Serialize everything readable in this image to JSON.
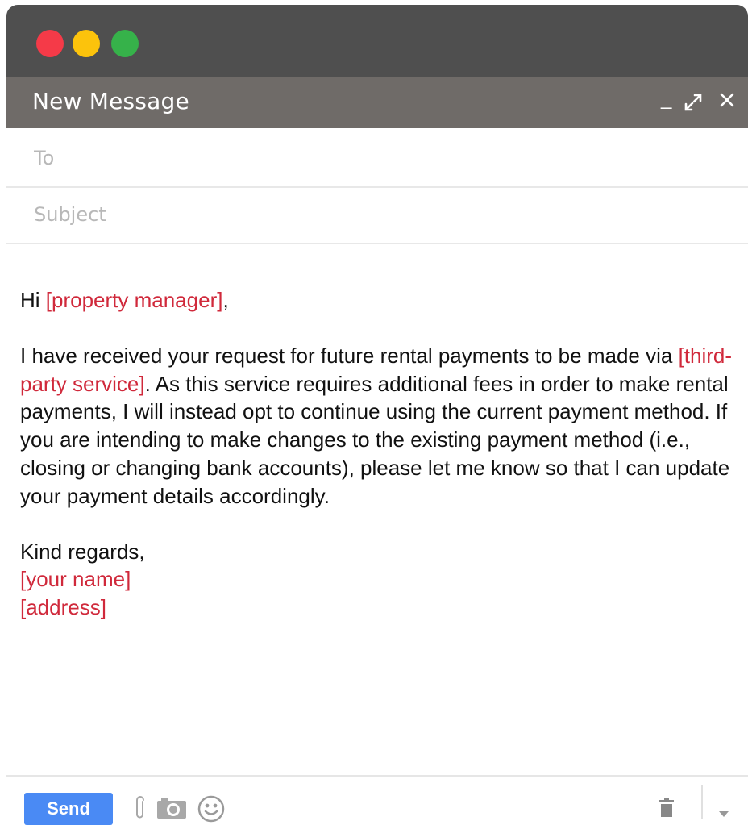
{
  "window": {
    "traffic_lights": [
      {
        "name": "close",
        "color": "#f53a48"
      },
      {
        "name": "minimize",
        "color": "#fcc30c"
      },
      {
        "name": "zoom",
        "color": "#36b24a"
      }
    ],
    "titlebar_color": "#4f4f4f"
  },
  "header": {
    "title": "New Message",
    "minimize_glyph": "_",
    "expand_glyph": "⤢",
    "close_glyph": "×",
    "background": "#6f6b68"
  },
  "fields": {
    "to": {
      "value": "",
      "placeholder": "To"
    },
    "subject": {
      "value": "",
      "placeholder": "Subject"
    }
  },
  "message": {
    "greeting_prefix": "Hi ",
    "greeting_placeholder": "[property manager]",
    "greeting_suffix": ",",
    "para_1": "I have received your request for future rental payments to be made via ",
    "para_placeholder": "[third-party service]",
    "para_2": ". As this service requires additional fees in order to make rental payments, I will instead opt to continue using the current payment method. If you are intending to make changes to the existing payment method (i.e., closing or changing bank accounts), please let me know so that I can update your payment details accordingly.",
    "closing": "Kind regards,",
    "signature_name": "[your name]",
    "signature_address": "[address]",
    "placeholder_color": "#d0293b"
  },
  "footer": {
    "send_label": "Send",
    "send_color": "#4a8af4",
    "icons": [
      "paperclip-icon",
      "camera-icon",
      "emoji-icon",
      "trash-icon",
      "dropdown-arrow-icon"
    ]
  }
}
